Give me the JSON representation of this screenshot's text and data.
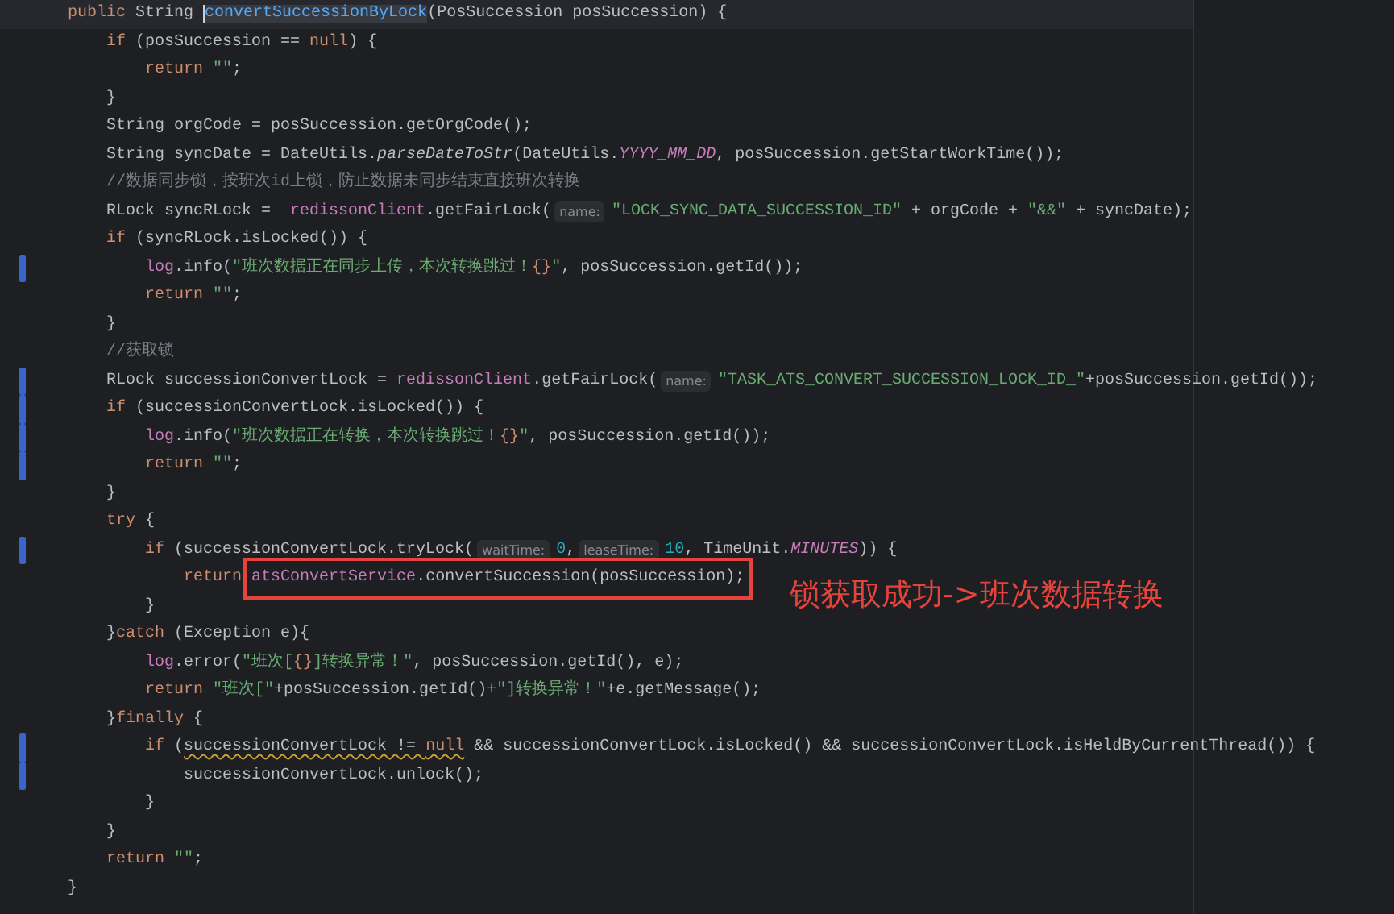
{
  "editor": {
    "lines": [
      {
        "current": true,
        "segments": [
          {
            "kind": "code",
            "tokens": [
              {
                "kind": "kw",
                "text": "    public "
              },
              {
                "kind": "plain",
                "text": "String "
              },
              {
                "kind": "method",
                "text": "convertSuccessionByLock",
                "caret": true
              },
              {
                "kind": "plain",
                "text": "(PosSuccession posSuccession) {"
              }
            ]
          }
        ]
      },
      {
        "segments": [
          {
            "kind": "code",
            "tokens": [
              {
                "kind": "kw",
                "text": "        if "
              },
              {
                "kind": "plain",
                "text": "(posSuccession == "
              },
              {
                "kind": "kw",
                "text": "null"
              },
              {
                "kind": "plain",
                "text": ") {"
              }
            ]
          }
        ]
      },
      {
        "segments": [
          {
            "kind": "code",
            "tokens": [
              {
                "kind": "kw",
                "text": "            return "
              },
              {
                "kind": "str",
                "text": "\"\""
              },
              {
                "kind": "plain",
                "text": ";"
              }
            ]
          }
        ]
      },
      {
        "segments": [
          {
            "kind": "code",
            "tokens": [
              {
                "kind": "plain",
                "text": "        }"
              }
            ]
          }
        ]
      },
      {
        "segments": [
          {
            "kind": "code",
            "tokens": [
              {
                "kind": "plain",
                "text": "        String orgCode = posSuccession.getOrgCode();"
              }
            ]
          }
        ]
      },
      {
        "segments": [
          {
            "kind": "code",
            "tokens": [
              {
                "kind": "plain",
                "text": "        String syncDate = DateUtils."
              },
              {
                "kind": "italic",
                "text": "parseDateToStr"
              },
              {
                "kind": "plain",
                "text": "(DateUtils."
              },
              {
                "kind": "static",
                "text": "YYYY_MM_DD"
              },
              {
                "kind": "plain",
                "text": ", posSuccession.getStartWorkTime());"
              }
            ]
          }
        ]
      },
      {
        "segments": [
          {
            "kind": "code",
            "tokens": [
              {
                "kind": "comment",
                "text": "        //数据同步锁，按班次id上锁，防止数据未同步结束直接班次转换"
              }
            ]
          }
        ]
      },
      {
        "segments": [
          {
            "kind": "code",
            "tokens": [
              {
                "kind": "plain",
                "text": "        RLock syncRLock =  "
              },
              {
                "kind": "field",
                "text": "redissonClient"
              },
              {
                "kind": "plain",
                "text": ".getFairLock("
              }
            ]
          },
          {
            "kind": "hint",
            "text": "name:"
          },
          {
            "kind": "code",
            "tokens": [
              {
                "kind": "str",
                "text": "\"LOCK_SYNC_DATA_SUCCESSION_ID\""
              },
              {
                "kind": "plain",
                "text": " + orgCode + "
              },
              {
                "kind": "str",
                "text": "\"&&\""
              },
              {
                "kind": "plain",
                "text": " + syncDate);"
              }
            ]
          }
        ]
      },
      {
        "segments": [
          {
            "kind": "code",
            "tokens": [
              {
                "kind": "kw",
                "text": "        if "
              },
              {
                "kind": "plain",
                "text": "(syncRLock.isLocked()) {"
              }
            ]
          }
        ]
      },
      {
        "changed": true,
        "segments": [
          {
            "kind": "code",
            "tokens": [
              {
                "kind": "field",
                "text": "            log"
              },
              {
                "kind": "plain",
                "text": ".info("
              },
              {
                "kind": "str",
                "text": "\"班次数据正在同步上传，本次转换跳过！"
              },
              {
                "kind": "format",
                "text": "{}"
              },
              {
                "kind": "str",
                "text": "\""
              },
              {
                "kind": "plain",
                "text": ", posSuccession.getId());"
              }
            ]
          }
        ]
      },
      {
        "segments": [
          {
            "kind": "code",
            "tokens": [
              {
                "kind": "kw",
                "text": "            return "
              },
              {
                "kind": "str",
                "text": "\"\""
              },
              {
                "kind": "plain",
                "text": ";"
              }
            ]
          }
        ]
      },
      {
        "segments": [
          {
            "kind": "code",
            "tokens": [
              {
                "kind": "plain",
                "text": "        }"
              }
            ]
          }
        ]
      },
      {
        "segments": [
          {
            "kind": "code",
            "tokens": [
              {
                "kind": "comment",
                "text": "        //获取锁"
              }
            ]
          }
        ]
      },
      {
        "changed": true,
        "segments": [
          {
            "kind": "code",
            "tokens": [
              {
                "kind": "plain",
                "text": "        RLock successionConvertLock = "
              },
              {
                "kind": "field",
                "text": "redissonClient"
              },
              {
                "kind": "plain",
                "text": ".getFairLock("
              }
            ]
          },
          {
            "kind": "hint",
            "text": "name:"
          },
          {
            "kind": "code",
            "tokens": [
              {
                "kind": "str",
                "text": "\"TASK_ATS_CONVERT_SUCCESSION_LOCK_ID_\""
              },
              {
                "kind": "plain",
                "text": "+posSuccession.getId());"
              }
            ]
          }
        ]
      },
      {
        "changed": true,
        "segments": [
          {
            "kind": "code",
            "tokens": [
              {
                "kind": "kw",
                "text": "        if "
              },
              {
                "kind": "plain",
                "text": "(successionConvertLock.isLocked()) {"
              }
            ]
          }
        ]
      },
      {
        "changed": true,
        "segments": [
          {
            "kind": "code",
            "tokens": [
              {
                "kind": "field",
                "text": "            log"
              },
              {
                "kind": "plain",
                "text": ".info("
              },
              {
                "kind": "str",
                "text": "\"班次数据正在转换，本次转换跳过！"
              },
              {
                "kind": "format",
                "text": "{}"
              },
              {
                "kind": "str",
                "text": "\""
              },
              {
                "kind": "plain",
                "text": ", posSuccession.getId());"
              }
            ]
          }
        ]
      },
      {
        "changed": true,
        "segments": [
          {
            "kind": "code",
            "tokens": [
              {
                "kind": "kw",
                "text": "            return "
              },
              {
                "kind": "str",
                "text": "\"\""
              },
              {
                "kind": "plain",
                "text": ";"
              }
            ]
          }
        ]
      },
      {
        "segments": [
          {
            "kind": "code",
            "tokens": [
              {
                "kind": "plain",
                "text": "        }"
              }
            ]
          }
        ]
      },
      {
        "segments": [
          {
            "kind": "code",
            "tokens": [
              {
                "kind": "kw",
                "text": "        try "
              },
              {
                "kind": "plain",
                "text": "{"
              }
            ]
          }
        ]
      },
      {
        "changed": true,
        "segments": [
          {
            "kind": "code",
            "tokens": [
              {
                "kind": "kw",
                "text": "            if "
              },
              {
                "kind": "plain",
                "text": "(successionConvertLock.tryLock("
              }
            ]
          },
          {
            "kind": "hint",
            "text": "waitTime:"
          },
          {
            "kind": "code",
            "tokens": [
              {
                "kind": "num",
                "text": "0"
              },
              {
                "kind": "plain",
                "text": ","
              }
            ]
          },
          {
            "kind": "hint",
            "text": "leaseTime:"
          },
          {
            "kind": "code",
            "tokens": [
              {
                "kind": "num",
                "text": "10"
              },
              {
                "kind": "plain",
                "text": ", TimeUnit."
              },
              {
                "kind": "static",
                "text": "MINUTES"
              },
              {
                "kind": "plain",
                "text": ")) {"
              }
            ]
          }
        ]
      },
      {
        "segments": [
          {
            "kind": "code",
            "tokens": [
              {
                "kind": "kw",
                "text": "                return"
              }
            ]
          },
          {
            "kind": "code",
            "boxed": true,
            "tokens": [
              {
                "kind": "field",
                "text": "atsConvertService"
              },
              {
                "kind": "plain",
                "text": ".convertSuccession(posSuccession);"
              }
            ]
          }
        ]
      },
      {
        "segments": [
          {
            "kind": "code",
            "tokens": [
              {
                "kind": "plain",
                "text": "            }"
              }
            ]
          }
        ]
      },
      {
        "segments": [
          {
            "kind": "code",
            "tokens": [
              {
                "kind": "plain",
                "text": "        }"
              },
              {
                "kind": "kw",
                "text": "catch "
              },
              {
                "kind": "plain",
                "text": "(Exception e){"
              }
            ]
          }
        ]
      },
      {
        "segments": [
          {
            "kind": "code",
            "tokens": [
              {
                "kind": "field",
                "text": "            log"
              },
              {
                "kind": "plain",
                "text": ".error("
              },
              {
                "kind": "str",
                "text": "\"班次["
              },
              {
                "kind": "format",
                "text": "{}"
              },
              {
                "kind": "str",
                "text": "]转换异常！\""
              },
              {
                "kind": "plain",
                "text": ", posSuccession.getId(), e);"
              }
            ]
          }
        ]
      },
      {
        "segments": [
          {
            "kind": "code",
            "tokens": [
              {
                "kind": "kw",
                "text": "            return "
              },
              {
                "kind": "str",
                "text": "\"班次[\""
              },
              {
                "kind": "plain",
                "text": "+posSuccession.getId()+"
              },
              {
                "kind": "str",
                "text": "\"]转换异常！\""
              },
              {
                "kind": "plain",
                "text": "+e.getMessage();"
              }
            ]
          }
        ]
      },
      {
        "segments": [
          {
            "kind": "code",
            "tokens": [
              {
                "kind": "plain",
                "text": "        }"
              },
              {
                "kind": "kw",
                "text": "finally "
              },
              {
                "kind": "plain",
                "text": "{"
              }
            ]
          }
        ]
      },
      {
        "changed": true,
        "segments": [
          {
            "kind": "code",
            "tokens": [
              {
                "kind": "kw",
                "text": "            if "
              },
              {
                "kind": "plain",
                "text": "("
              },
              {
                "kind": "plain",
                "text": "successionConvertLock != ",
                "warning": true
              },
              {
                "kind": "kw",
                "text": "null",
                "warning": true
              },
              {
                "kind": "plain",
                "text": " && successionConvertLock.isLocked() && successionConvertLock.isHeldByCurrentThread()) {"
              }
            ]
          }
        ]
      },
      {
        "changed": true,
        "segments": [
          {
            "kind": "code",
            "tokens": [
              {
                "kind": "plain",
                "text": "                successionConvertLock.unlock();"
              }
            ]
          }
        ]
      },
      {
        "segments": [
          {
            "kind": "code",
            "tokens": [
              {
                "kind": "plain",
                "text": "            }"
              }
            ]
          }
        ]
      },
      {
        "segments": [
          {
            "kind": "code",
            "tokens": [
              {
                "kind": "plain",
                "text": "        }"
              }
            ]
          }
        ]
      },
      {
        "segments": [
          {
            "kind": "code",
            "tokens": [
              {
                "kind": "kw",
                "text": "        return "
              },
              {
                "kind": "str",
                "text": "\"\""
              },
              {
                "kind": "plain",
                "text": ";"
              }
            ]
          }
        ]
      },
      {
        "segments": [
          {
            "kind": "code",
            "tokens": [
              {
                "kind": "plain",
                "text": "    }"
              }
            ]
          }
        ]
      }
    ]
  },
  "annotation": {
    "text": "锁获取成功->班次数据转换"
  }
}
